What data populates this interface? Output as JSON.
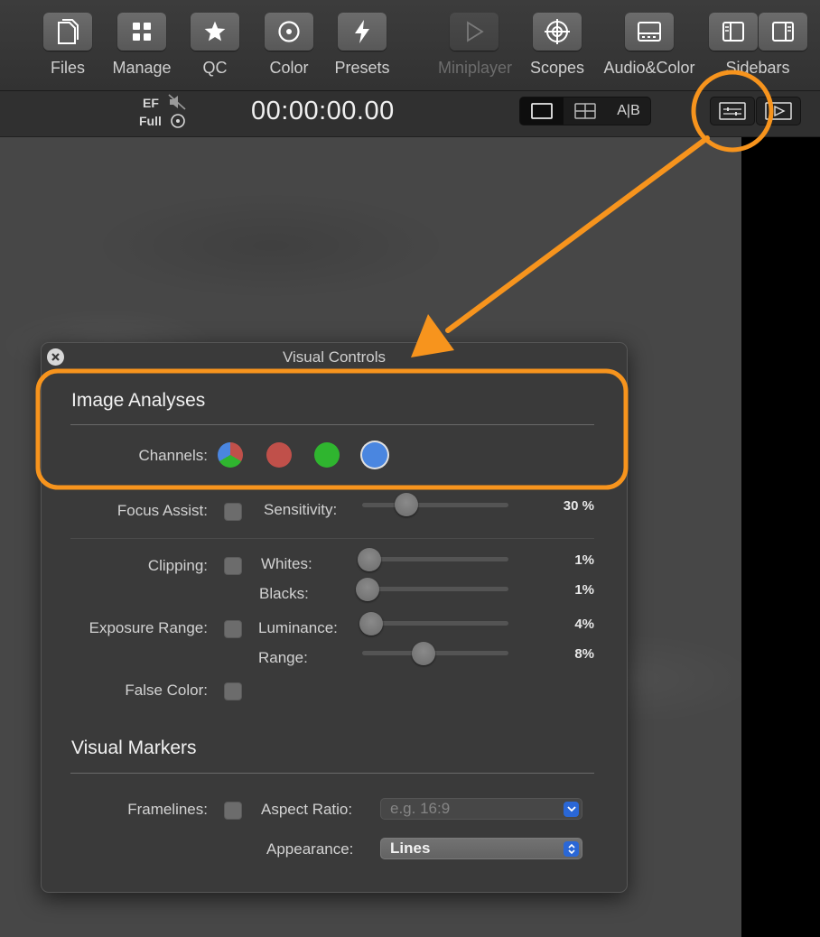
{
  "toolbar": {
    "items": [
      {
        "label": "Files",
        "icon": "document-icon"
      },
      {
        "label": "Manage",
        "icon": "grid-icon"
      },
      {
        "label": "QC",
        "icon": "star-icon"
      },
      {
        "label": "Color",
        "icon": "color-circle-icon"
      },
      {
        "label": "Presets",
        "icon": "bolt-icon"
      },
      {
        "label": "Miniplayer",
        "icon": "play-icon",
        "disabled": true
      },
      {
        "label": "Scopes",
        "icon": "crosshair-icon"
      },
      {
        "label": "Audio&Color",
        "icon": "panel-icon"
      },
      {
        "label": "Sidebars",
        "icon": "sidebar-icons"
      }
    ]
  },
  "viewer": {
    "ef_label": "EF",
    "full_label": "Full",
    "timecode": "00:00:00.00",
    "ab_label": "A|B"
  },
  "panel": {
    "title": "Visual Controls",
    "image_analyses": {
      "heading": "Image Analyses",
      "channels_label": "Channels:",
      "channels": [
        "rgb",
        "red",
        "green",
        "blue"
      ]
    },
    "focus_assist": {
      "label": "Focus Assist:",
      "sensitivity_label": "Sensitivity:",
      "sensitivity_value": "30 %",
      "sensitivity_fraction": 0.3
    },
    "clipping": {
      "label": "Clipping:",
      "whites_label": "Whites:",
      "whites_value": "1%",
      "whites_fraction": 0.05,
      "blacks_label": "Blacks:",
      "blacks_value": "1%",
      "blacks_fraction": 0.04
    },
    "exposure": {
      "label": "Exposure Range:",
      "luminance_label": "Luminance:",
      "luminance_value": "4%",
      "luminance_fraction": 0.06,
      "range_label": "Range:",
      "range_value": "8%",
      "range_fraction": 0.42
    },
    "false_color": {
      "label": "False Color:"
    },
    "visual_markers": {
      "heading": "Visual Markers",
      "framelines_label": "Framelines:",
      "aspect_label": "Aspect Ratio:",
      "aspect_placeholder": "e.g. 16:9",
      "appearance_label": "Appearance:",
      "appearance_value": "Lines"
    }
  },
  "colors": {
    "accent_orange": "#f7941d",
    "select_blue": "#2a67d6",
    "channel_red": "#c0504a",
    "channel_green": "#2fb52f",
    "channel_blue": "#4a86e0"
  }
}
